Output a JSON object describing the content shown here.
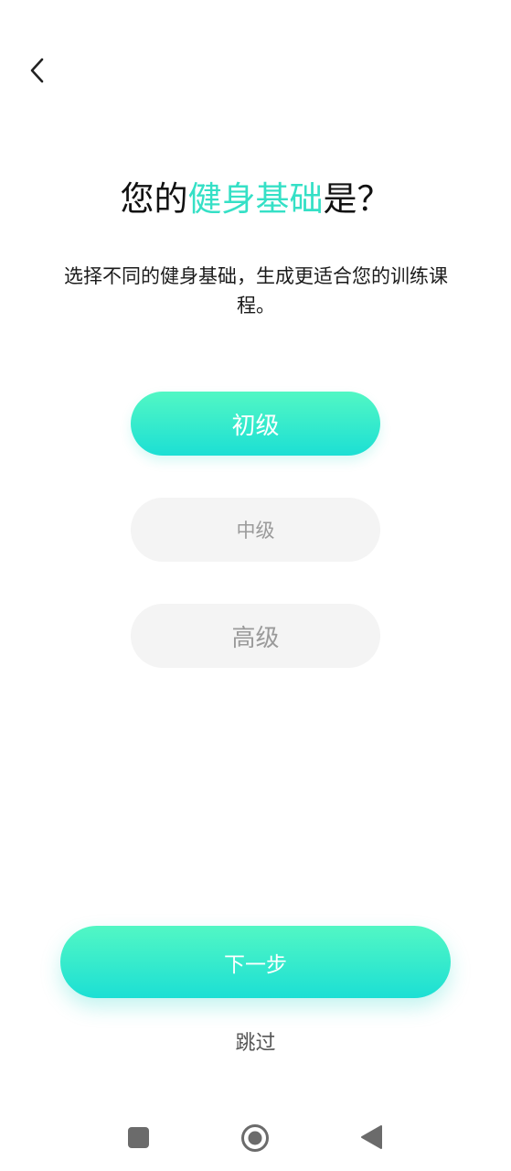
{
  "header": {
    "back_icon": "chevron-left-icon"
  },
  "title": {
    "prefix": "您的",
    "highlight": "健身基础",
    "suffix": "是？",
    "accent_color": "#35e0c6"
  },
  "subtitle": "选择不同的健身基础，生成更适合您的训练课程。",
  "levels": [
    {
      "label": "初级",
      "selected": true
    },
    {
      "label": "中级",
      "selected": false
    },
    {
      "label": "高级",
      "selected": false
    }
  ],
  "actions": {
    "next_label": "下一步",
    "skip_label": "跳过"
  },
  "colors": {
    "gradient_top": "#52f7c4",
    "gradient_bottom": "#1cdfd4",
    "inactive_bg": "#f4f4f4",
    "inactive_text": "#9a9a9a"
  },
  "system_nav": {
    "recent_icon": "square-icon",
    "home_icon": "home-circle-icon",
    "back_icon": "triangle-back-icon"
  }
}
